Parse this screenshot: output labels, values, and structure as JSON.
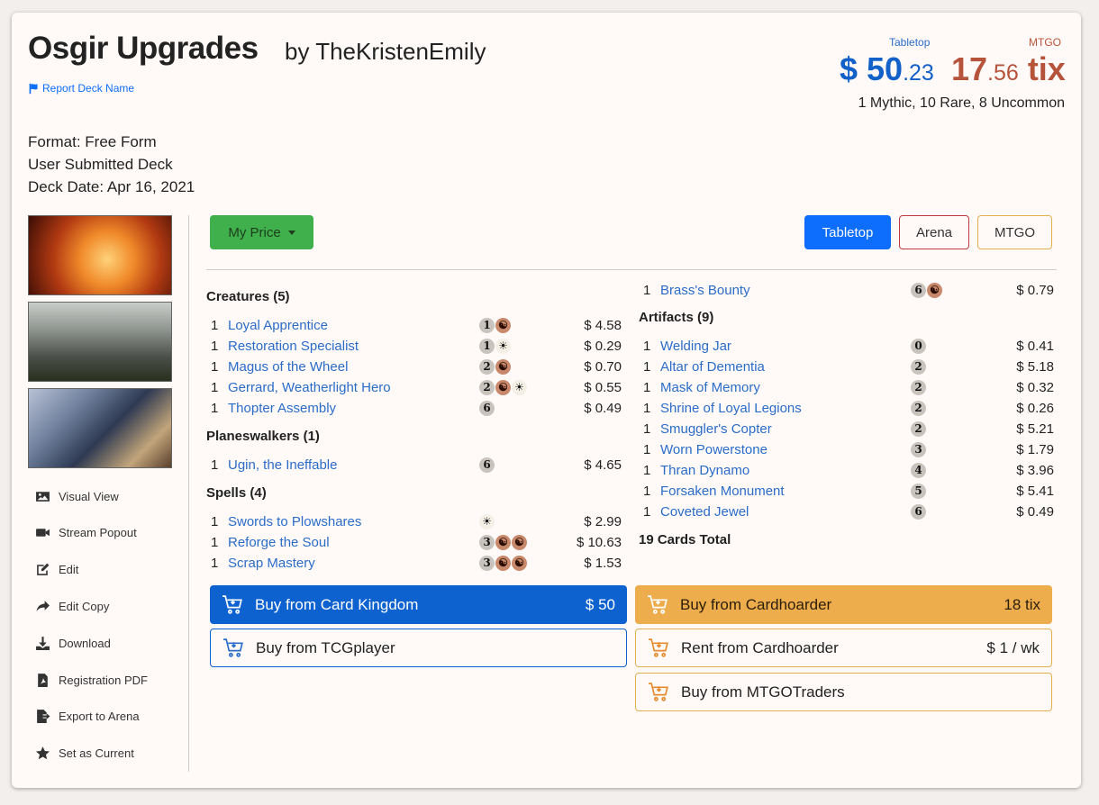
{
  "deck": {
    "title": "Osgir Upgrades",
    "byline": "by TheKristenEmily",
    "report_label": "Report Deck Name",
    "format": "Format: Free Form",
    "submitted": "User Submitted Deck",
    "date": "Deck Date: Apr 16, 2021"
  },
  "prices": {
    "tabletop_label": "Tabletop",
    "mtgo_label": "MTGO",
    "tabletop_main": "$ 50",
    "tabletop_cents": ".23",
    "mtgo_main": "17",
    "mtgo_cents": ".56",
    "mtgo_unit": " tix",
    "rarity_summary": "1 Mythic, 10 Rare, 8 Uncommon"
  },
  "sidebar": {
    "items": [
      {
        "label": "Visual View",
        "icon": "image-icon"
      },
      {
        "label": "Stream Popout",
        "icon": "video-icon"
      },
      {
        "label": "Edit",
        "icon": "edit-icon"
      },
      {
        "label": "Edit Copy",
        "icon": "share-icon"
      },
      {
        "label": "Download",
        "icon": "download-icon"
      },
      {
        "label": "Registration PDF",
        "icon": "pdf-icon"
      },
      {
        "label": "Export to Arena",
        "icon": "export-icon"
      },
      {
        "label": "Set as Current",
        "icon": "star-icon"
      }
    ]
  },
  "toolbar": {
    "my_price": "My Price",
    "tabletop": "Tabletop",
    "arena": "Arena",
    "mtgo": "MTGO"
  },
  "sections": {
    "creatures": "Creatures (5)",
    "planeswalkers": "Planeswalkers (1)",
    "spells": "Spells (4)",
    "artifacts": "Artifacts (9)",
    "total": "19 Cards Total"
  },
  "cards": {
    "creatures": [
      {
        "qty": "1",
        "name": "Loyal Apprentice",
        "price": "$ 4.58",
        "mana": [
          "1",
          "R"
        ]
      },
      {
        "qty": "1",
        "name": "Restoration Specialist",
        "price": "$ 0.29",
        "mana": [
          "1",
          "W"
        ]
      },
      {
        "qty": "1",
        "name": "Magus of the Wheel",
        "price": "$ 0.70",
        "mana": [
          "2",
          "R"
        ]
      },
      {
        "qty": "1",
        "name": "Gerrard, Weatherlight Hero",
        "price": "$ 0.55",
        "mana": [
          "2",
          "R",
          "W"
        ]
      },
      {
        "qty": "1",
        "name": "Thopter Assembly",
        "price": "$ 0.49",
        "mana": [
          "6"
        ]
      }
    ],
    "planeswalkers": [
      {
        "qty": "1",
        "name": "Ugin, the Ineffable",
        "price": "$ 4.65",
        "mana": [
          "6"
        ]
      }
    ],
    "spells": [
      {
        "qty": "1",
        "name": "Swords to Plowshares",
        "price": "$ 2.99",
        "mana": [
          "W"
        ]
      },
      {
        "qty": "1",
        "name": "Reforge the Soul",
        "price": "$ 10.63",
        "mana": [
          "3",
          "R",
          "R"
        ]
      },
      {
        "qty": "1",
        "name": "Scrap Mastery",
        "price": "$ 1.53",
        "mana": [
          "3",
          "R",
          "R"
        ]
      }
    ],
    "spells_cont": [
      {
        "qty": "1",
        "name": "Brass's Bounty",
        "price": "$ 0.79",
        "mana": [
          "6",
          "R"
        ]
      }
    ],
    "artifacts": [
      {
        "qty": "1",
        "name": "Welding Jar",
        "price": "$ 0.41",
        "mana": [
          "0"
        ]
      },
      {
        "qty": "1",
        "name": "Altar of Dementia",
        "price": "$ 5.18",
        "mana": [
          "2"
        ]
      },
      {
        "qty": "1",
        "name": "Mask of Memory",
        "price": "$ 0.32",
        "mana": [
          "2"
        ]
      },
      {
        "qty": "1",
        "name": "Shrine of Loyal Legions",
        "price": "$ 0.26",
        "mana": [
          "2"
        ]
      },
      {
        "qty": "1",
        "name": "Smuggler's Copter",
        "price": "$ 5.21",
        "mana": [
          "2"
        ]
      },
      {
        "qty": "1",
        "name": "Worn Powerstone",
        "price": "$ 1.79",
        "mana": [
          "3"
        ]
      },
      {
        "qty": "1",
        "name": "Thran Dynamo",
        "price": "$ 3.96",
        "mana": [
          "4"
        ]
      },
      {
        "qty": "1",
        "name": "Forsaken Monument",
        "price": "$ 5.41",
        "mana": [
          "5"
        ]
      },
      {
        "qty": "1",
        "name": "Coveted Jewel",
        "price": "$ 0.49",
        "mana": [
          "6"
        ]
      }
    ]
  },
  "buy": {
    "card_kingdom": "Buy from Card Kingdom",
    "card_kingdom_price": "$ 50",
    "tcgplayer": "Buy from TCGplayer",
    "cardhoarder": "Buy from Cardhoarder",
    "cardhoarder_price": "18 tix",
    "rent_cardhoarder": "Rent from Cardhoarder",
    "rent_price": "$ 1 / wk",
    "mtgotraders": "Buy from MTGOTraders"
  },
  "colors": {
    "tabletop_blue": "#1261c9",
    "mtgo_red": "#b5543a",
    "my_price_green": "#3fb04b",
    "cardhoarder_orange": "#eead4c",
    "link_blue": "#2a6cc8"
  }
}
